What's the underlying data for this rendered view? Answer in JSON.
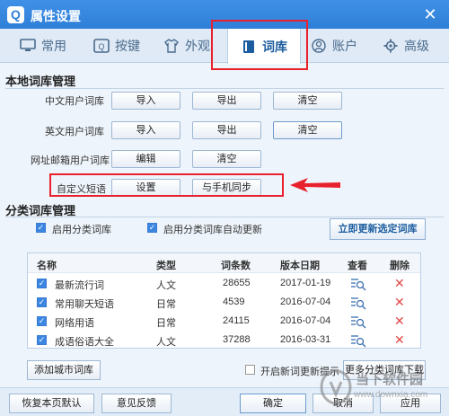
{
  "window": {
    "title": "属性设置",
    "logo_letter": "Q",
    "close_glyph": "✕"
  },
  "tabs": [
    {
      "label": "常用",
      "icon": "monitor-icon"
    },
    {
      "label": "按键",
      "icon": "q-key-icon"
    },
    {
      "label": "外观",
      "icon": "shirt-icon"
    },
    {
      "label": "词库",
      "icon": "book-icon",
      "active": true
    },
    {
      "label": "账户",
      "icon": "user-icon"
    },
    {
      "label": "高级",
      "icon": "gear-icon"
    }
  ],
  "local": {
    "title": "本地词库管理",
    "rows": [
      {
        "label": "中文用户词库",
        "buttons": [
          "导入",
          "导出",
          "清空"
        ]
      },
      {
        "label": "英文用户词库",
        "buttons": [
          "导入",
          "导出",
          "清空"
        ]
      },
      {
        "label": "网址邮箱用户词库",
        "buttons": [
          "编辑",
          "清空"
        ]
      },
      {
        "label": "自定义短语",
        "buttons": [
          "设置",
          "与手机同步"
        ]
      }
    ]
  },
  "category": {
    "title": "分类词库管理",
    "enable_label": "启用分类词库",
    "auto_update_label": "启用分类词库自动更新",
    "update_now_label": "立即更新选定词库",
    "columns": [
      "名称",
      "类型",
      "词条数",
      "版本日期",
      "查看",
      "删除"
    ],
    "rows": [
      {
        "name": "最新流行词",
        "type": "人文",
        "count": "28655",
        "date": "2017-01-19"
      },
      {
        "name": "常用聊天短语",
        "type": "日常",
        "count": "4539",
        "date": "2016-07-04"
      },
      {
        "name": "网络用语",
        "type": "日常",
        "count": "24115",
        "date": "2016-07-04"
      },
      {
        "name": "成语俗语大全",
        "type": "人文",
        "count": "37288",
        "date": "2016-03-31"
      }
    ],
    "add_city_label": "添加城市词库",
    "new_word_tip_label": "开启新词更新提示",
    "more_download_label": "更多分类词库下载"
  },
  "footer": {
    "restore_label": "恢复本页默认",
    "feedback_label": "意见反馈",
    "ok_label": "确定",
    "cancel_label": "取消",
    "apply_label": "应用"
  },
  "watermark": {
    "line1": "当下软件园",
    "line2": "www.downxia.com"
  },
  "colors": {
    "titlebar": "#2f7fd8",
    "highlight_red": "#e8212c",
    "accent_blue": "#3a86e0"
  }
}
